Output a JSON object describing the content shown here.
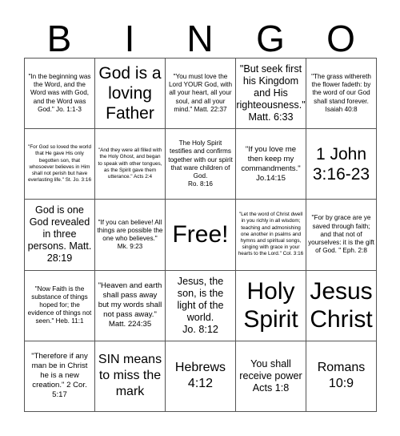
{
  "header": {
    "letters": [
      "B",
      "I",
      "N",
      "G",
      "O"
    ]
  },
  "cells": [
    {
      "text": "\"In the beginning was the Word, and the Word was with God, and the Word was God.\" Jo. 1:1-3",
      "size": "s-sm"
    },
    {
      "text": "God is a loving Father",
      "size": "s-xxl"
    },
    {
      "text": "\"You must love the Lord YOUR God, with all your heart, all your soul, and all your mind.\" Matt. 22:37",
      "size": "s-sm"
    },
    {
      "text": "\"But seek first his Kingdom and His righteousness.\" Matt. 6:33",
      "size": "s-lg"
    },
    {
      "text": "\"The grass withereth the flower fadeth: by the word of our God shall stand forever.\nIsaiah 40:8",
      "size": "s-sm"
    },
    {
      "text": "\"For God so loved the world that He gave His only begotten son, that whosoever believes in Him shall not perish but have everlasting life.\" St. Jo. 3:16",
      "size": "s-xs"
    },
    {
      "text": "\"And they were all filled with the Holy Ghost, and began to speak with other tongues, as the Spirit gave them utterance.\" Acts 2:4",
      "size": "s-xs"
    },
    {
      "text": "The Holy Spirit testifies and confirms together with our spirit that ware children of God.\nRo. 8:16",
      "size": "s-sm"
    },
    {
      "text": "\"If you love me then keep my commandments.\" Jo.14:15",
      "size": "s-md"
    },
    {
      "text": "1 John 3:16-23",
      "size": "s-xxl"
    },
    {
      "text": "God is one God revealed in three persons. Matt. 28:19",
      "size": "s-lg"
    },
    {
      "text": "\"If you can believe! All things are possible the one who believes.\" Mk. 9:23",
      "size": "s-sm"
    },
    {
      "text": "Free!",
      "size": "s-xxxl"
    },
    {
      "text": "\"Let the word of Christ dwell in you richly in all wisdom; teaching and admonishing one another in psalms and hymns and spiritual songs, singing with grace in your hearts to the Lord.\" Col. 3:16",
      "size": "s-xs"
    },
    {
      "text": "\"For by grace are ye saved through faith; and that not of yourselves: it is the gift of God. \" Eph. 2:8",
      "size": "s-sm"
    },
    {
      "text": "\"Now Faith is the substance of things hoped for; the evidence of things not seen.\" Heb. 11:1",
      "size": "s-sm"
    },
    {
      "text": "\"Heaven and earth shall pass away but my words shall not pass away.\" Matt. 224:35",
      "size": "s-md"
    },
    {
      "text": "Jesus, the son, is the light of the world.\nJo. 8:12",
      "size": "s-lg"
    },
    {
      "text": "Holy Spirit",
      "size": "s-xxxl"
    },
    {
      "text": "Jesus Christ",
      "size": "s-xxxl"
    },
    {
      "text": "\"Therefore if any man be in Christ he is a new creation.\" 2 Cor. 5:17",
      "size": "s-md"
    },
    {
      "text": "SIN means to miss the mark",
      "size": "s-xl"
    },
    {
      "text": "Hebrews 4:12",
      "size": "s-xl"
    },
    {
      "text": "You shall receive power Acts 1:8",
      "size": "s-lg"
    },
    {
      "text": "Romans 10:9",
      "size": "s-xl"
    }
  ]
}
